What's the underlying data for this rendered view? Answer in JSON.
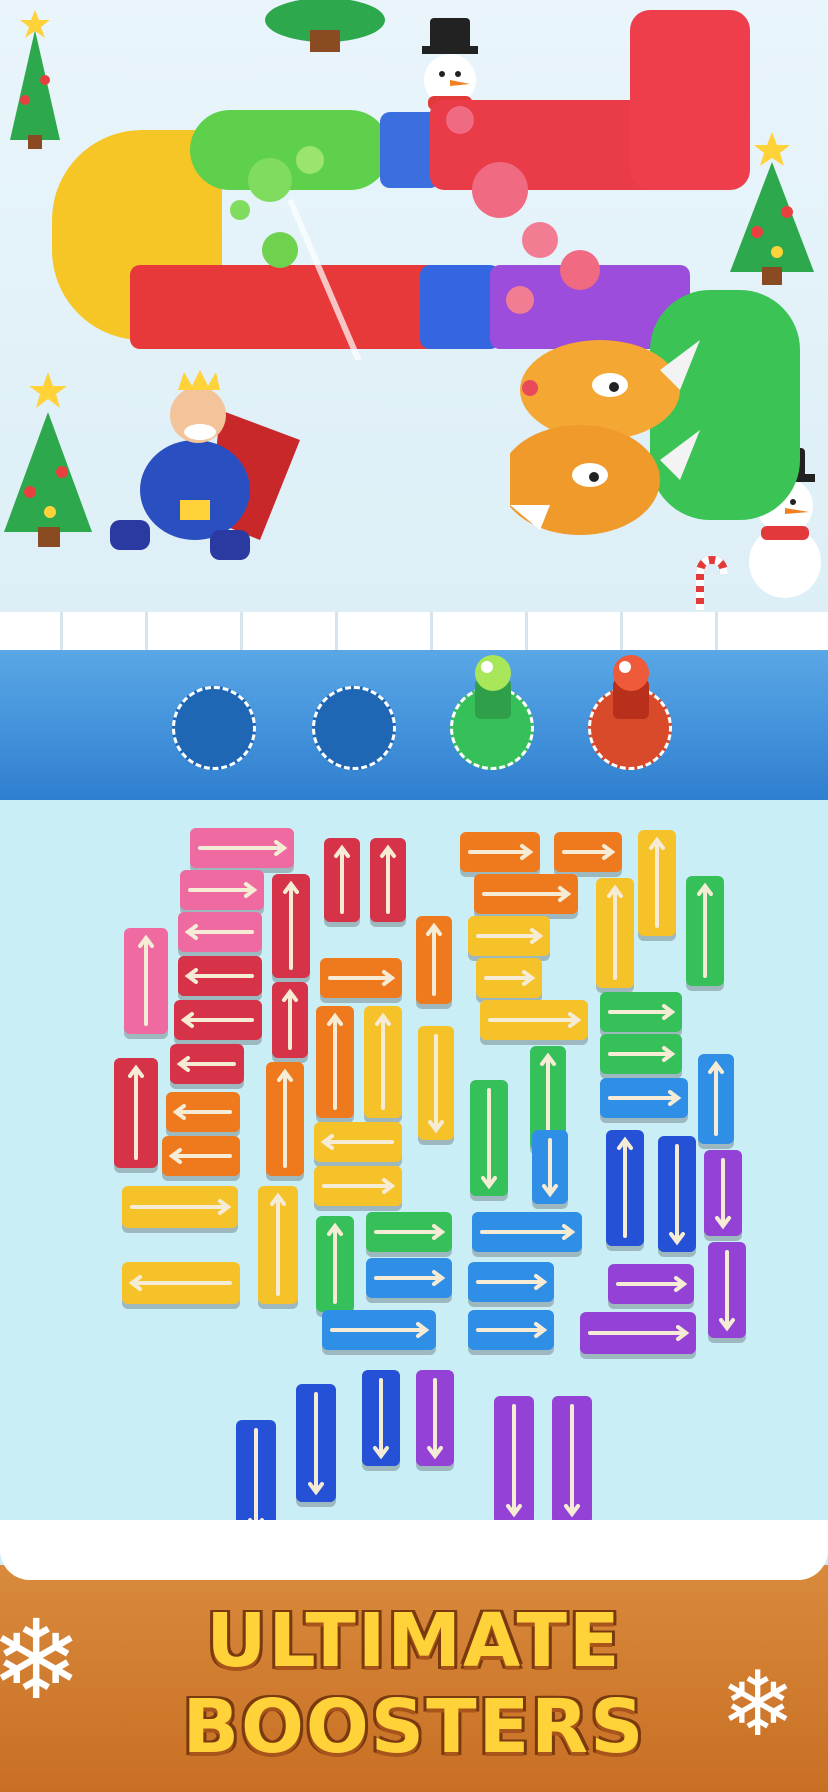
{
  "banner": {
    "line1": "ULTIMATE",
    "line2": "BOOSTERS"
  },
  "colors": {
    "pink": "#ee6aa0",
    "red": "#d63349",
    "orange": "#ef7a1e",
    "yellow": "#f6c229",
    "green": "#36c05a",
    "blue": "#2f8ee6",
    "navy": "#2451d6",
    "purple": "#9442d6",
    "arrow": "#f6ecd6",
    "board": "#c9eef5",
    "slotbar": "#3a8bd8"
  },
  "boosters": [
    {
      "name": "empty-slot",
      "filled": false,
      "color": ""
    },
    {
      "name": "empty-slot",
      "filled": false,
      "color": ""
    },
    {
      "name": "green-booster",
      "filled": true,
      "color": "#36c05a"
    },
    {
      "name": "red-booster",
      "filled": true,
      "color": "#d84a2a"
    }
  ],
  "characters": [
    "king",
    "dragon-head",
    "snowman",
    "christmas-tree",
    "candy-cane"
  ]
}
